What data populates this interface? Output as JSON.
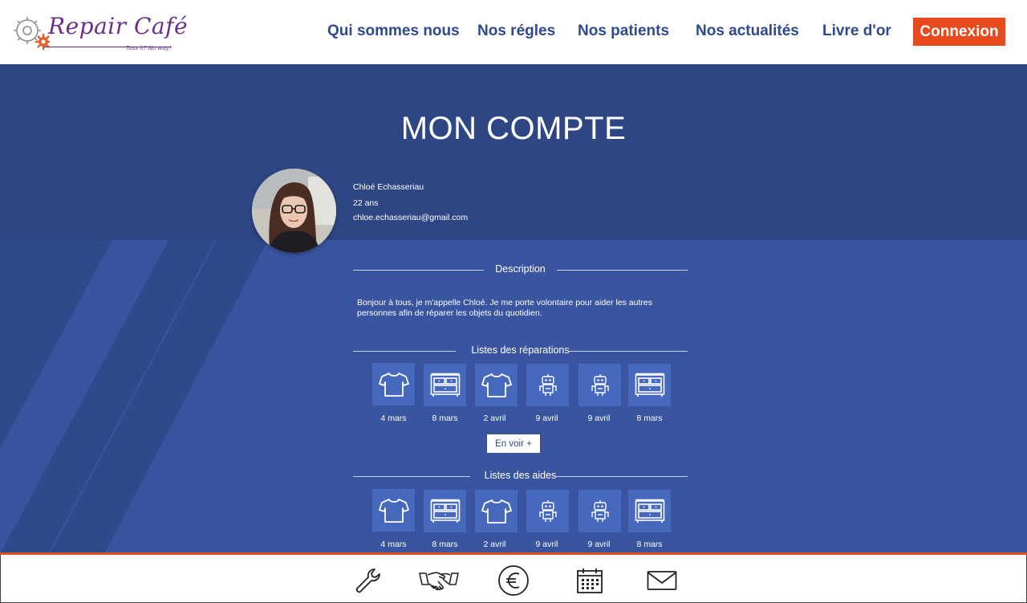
{
  "header": {
    "logo_text": "Repair Café",
    "logo_tagline": "Toss it? No way!",
    "nav": [
      "Qui sommes nous",
      "Nos régles",
      "Nos patients",
      "Nos actualités",
      "Livre d'or"
    ],
    "login_label": "Connexion"
  },
  "page": {
    "title": "MON COMPTE"
  },
  "profile": {
    "name": "Chloé Echasseriau",
    "age": "22 ans",
    "email": "chloe.echasseriau@gmail.com"
  },
  "description": {
    "heading": "Description",
    "text": "Bonjour à tous, je m'appelle Chloé. Je me porte volontaire pour aider les autres personnes afin de réparer les objets du quotidien."
  },
  "repairs": {
    "heading": "Listes des réparations",
    "items": [
      {
        "icon": "tshirt-icon",
        "date": "4 mars"
      },
      {
        "icon": "dresser-icon",
        "date": "8 mars"
      },
      {
        "icon": "tshirt-icon",
        "date": "2 avril"
      },
      {
        "icon": "robot-icon",
        "date": "9 avril"
      },
      {
        "icon": "robot-icon",
        "date": "9 avril"
      },
      {
        "icon": "dresser-icon",
        "date": "8 mars"
      }
    ],
    "see_more": "En voir +"
  },
  "aids": {
    "heading": "Listes des aides",
    "items": [
      {
        "icon": "tshirt-icon",
        "date": "4 mars"
      },
      {
        "icon": "dresser-icon",
        "date": "8 mars"
      },
      {
        "icon": "tshirt-icon",
        "date": "2 avril"
      },
      {
        "icon": "robot-icon",
        "date": "9 avril"
      },
      {
        "icon": "robot-icon",
        "date": "9 avril"
      },
      {
        "icon": "dresser-icon",
        "date": "8 mars"
      }
    ]
  },
  "footer": {
    "icons": [
      "wrench-icon",
      "handshake-icon",
      "euro-icon",
      "calendar-icon",
      "mail-icon"
    ]
  },
  "colors": {
    "header_bg": "#ffffff",
    "nav_text": "#2e4a8c",
    "accent": "#e84a1f",
    "hero_bg": "#2e4784",
    "body_bg": "#3a55a0",
    "tile_bg": "#4668bd"
  }
}
